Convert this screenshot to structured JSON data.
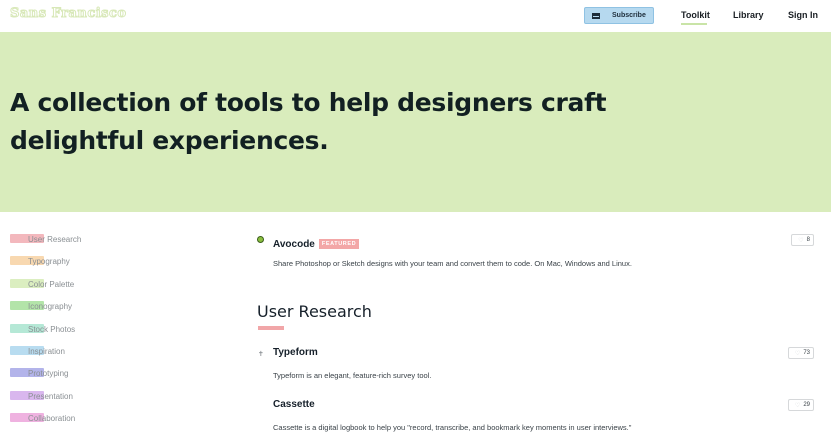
{
  "header": {
    "logo_text": "Sans Francisco",
    "subscribe_label": "Subscribe",
    "nav": {
      "toolkit": "Toolkit",
      "library": "Library",
      "signin": "Sign In"
    }
  },
  "hero": {
    "headline": "A collection of tools to help designers craft delightful experiences."
  },
  "sidebar": {
    "items": [
      {
        "label": "User Research",
        "color": "#f3b8bd"
      },
      {
        "label": "Typography",
        "color": "#f8d8b0"
      },
      {
        "label": "Color Palette",
        "color": "#dbeec0"
      },
      {
        "label": "Iconography",
        "color": "#b3e4a9"
      },
      {
        "label": "Stock Photos",
        "color": "#b5e8d6"
      },
      {
        "label": "Inspiration",
        "color": "#b8dcf0"
      },
      {
        "label": "Prototyping",
        "color": "#b3b4ea"
      },
      {
        "label": "Presentation",
        "color": "#d9b7ee"
      },
      {
        "label": "Collaboration",
        "color": "#efb2e0"
      }
    ]
  },
  "featured": {
    "name": "Avocode",
    "badge": "FEATURED",
    "description": "Share Photoshop or Sketch designs with your team and convert them to code. On Mac, Windows and Linux.",
    "likes": "8"
  },
  "section": {
    "title": "User Research"
  },
  "tools": [
    {
      "name": "Typeform",
      "description": "Typeform is an elegant, feature-rich survey tool.",
      "likes": "73"
    },
    {
      "name": "Cassette",
      "description": "Cassette is a digital logbook to help you \"record, transcribe, and bookmark key moments in user interviews.\"",
      "likes": "29"
    }
  ]
}
